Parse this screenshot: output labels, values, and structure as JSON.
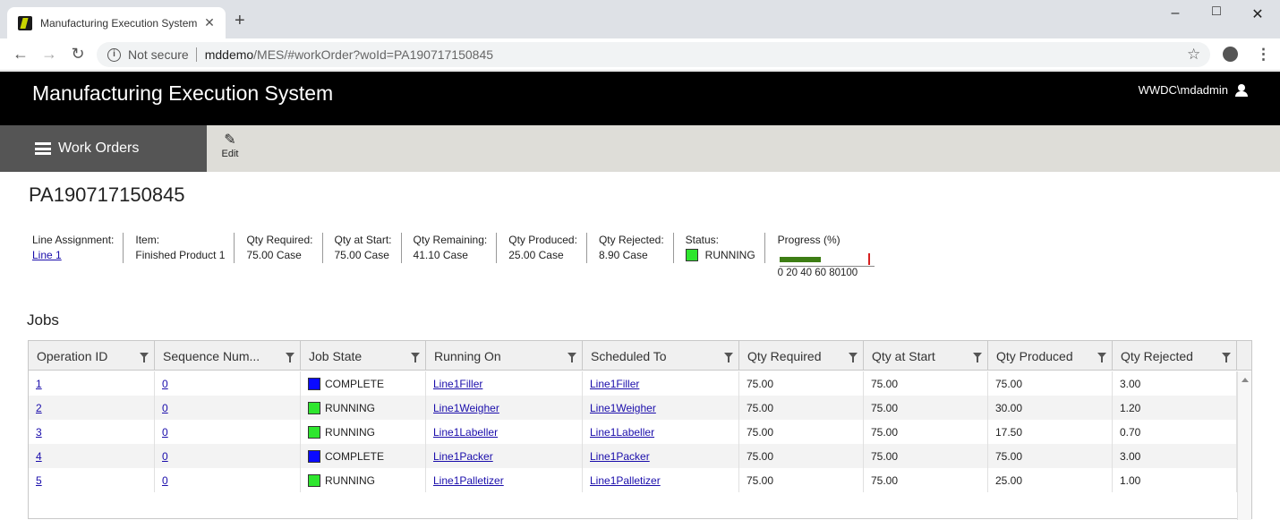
{
  "browser": {
    "tab_title": "Manufacturing Execution System",
    "tab_close": "✕",
    "new_tab": "+",
    "not_secure": "Not secure",
    "url_host": "mddemo",
    "url_path": "/MES/#workOrder?woId=PA190717150845"
  },
  "app": {
    "title": "Manufacturing Execution System",
    "user": "WWDC\\mdadmin"
  },
  "toolbar": {
    "work_orders_label": "Work Orders",
    "edit_label": "Edit"
  },
  "work_order": {
    "id": "PA190717150845",
    "line_assignment_label": "Line Assignment:",
    "line_assignment_value": "Line 1",
    "item_label": "Item:",
    "item_value": "Finished Product 1",
    "qty_required_label": "Qty Required:",
    "qty_required_value": "75.00 Case",
    "qty_at_start_label": "Qty at Start:",
    "qty_at_start_value": "75.00 Case",
    "qty_remaining_label": "Qty Remaining:",
    "qty_remaining_value": "41.10 Case",
    "qty_produced_label": "Qty Produced:",
    "qty_produced_value": "25.00 Case",
    "qty_rejected_label": "Qty Rejected:",
    "qty_rejected_value": "8.90 Case",
    "status_label": "Status:",
    "status_value": "RUNNING",
    "status_color": "#2ee62e",
    "progress_label": "Progress (%)",
    "progress_percent": 45,
    "progress_target_percent": 96,
    "progress_ticks": "0  20 40 60 80100"
  },
  "jobs": {
    "title": "Jobs",
    "columns": [
      "Operation ID",
      "Sequence Num...",
      "Job State",
      "Running On",
      "Scheduled To",
      "Qty Required",
      "Qty at Start",
      "Qty Produced",
      "Qty Rejected"
    ],
    "rows": [
      {
        "op": "1",
        "seq": "0",
        "state": "COMPLETE",
        "state_color": "#0a0aff",
        "running": "Line1Filler",
        "scheduled": "Line1Filler",
        "req": "75.00",
        "start": "75.00",
        "produced": "75.00",
        "rejected": "3.00"
      },
      {
        "op": "2",
        "seq": "0",
        "state": "RUNNING",
        "state_color": "#2ee62e",
        "running": "Line1Weigher",
        "scheduled": "Line1Weigher",
        "req": "75.00",
        "start": "75.00",
        "produced": "30.00",
        "rejected": "1.20"
      },
      {
        "op": "3",
        "seq": "0",
        "state": "RUNNING",
        "state_color": "#2ee62e",
        "running": "Line1Labeller",
        "scheduled": "Line1Labeller",
        "req": "75.00",
        "start": "75.00",
        "produced": "17.50",
        "rejected": "0.70"
      },
      {
        "op": "4",
        "seq": "0",
        "state": "COMPLETE",
        "state_color": "#0a0aff",
        "running": "Line1Packer",
        "scheduled": "Line1Packer",
        "req": "75.00",
        "start": "75.00",
        "produced": "75.00",
        "rejected": "3.00"
      },
      {
        "op": "5",
        "seq": "0",
        "state": "RUNNING",
        "state_color": "#2ee62e",
        "running": "Line1Palletizer",
        "scheduled": "Line1Palletizer",
        "req": "75.00",
        "start": "75.00",
        "produced": "25.00",
        "rejected": "1.00"
      }
    ]
  }
}
